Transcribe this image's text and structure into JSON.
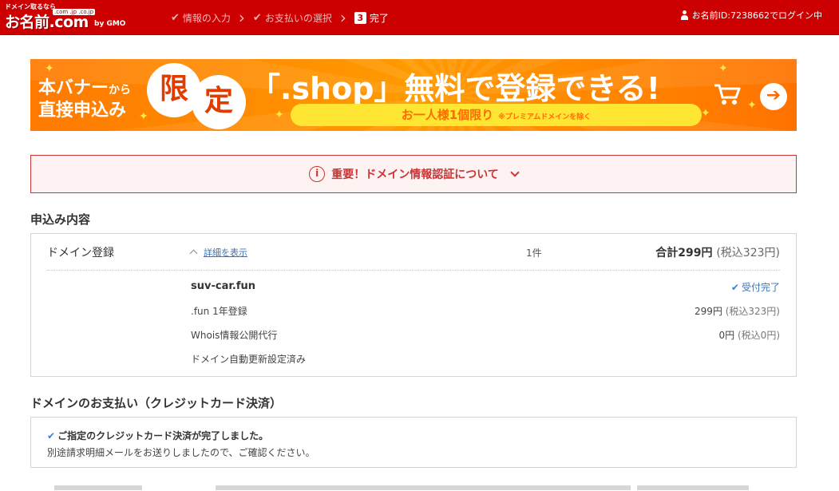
{
  "header": {
    "logo": {
      "tagline": "ドメイン取るなら",
      "tlds": ".com .jp .co.jp",
      "brand": "お名前.com",
      "by": "by GMO"
    },
    "steps": [
      {
        "label": "情報の入力",
        "state": "done"
      },
      {
        "label": "お支払いの選択",
        "state": "done"
      },
      {
        "number": "3",
        "label": "完了",
        "state": "current"
      }
    ],
    "login_status": "お名前ID:7238662でログイン中"
  },
  "banner": {
    "line1_a": "本バナー",
    "line1_b": "から",
    "line2": "直接申込み",
    "badge1": "限",
    "badge2": "定",
    "headline": "「.shop」無料で登録できる!",
    "pill_text": "お一人様1個限り",
    "pill_note": "※プレミアムドメインを除く",
    "arrow": "➔"
  },
  "notice": {
    "icon": "i",
    "text": "重要！ドメイン情報認証について"
  },
  "order_section": {
    "title": "申込み内容",
    "item_name": "ドメイン登録",
    "detail_link": "詳細を表示",
    "quantity": "1件",
    "total": "合計299円",
    "total_tax": "(税込323円)",
    "domain": "suv-car.fun",
    "status": "受付完了",
    "lines": [
      {
        "label": ".fun 1年登録",
        "price": "299円",
        "tax": "(税込323円)"
      },
      {
        "label": "Whois情報公開代行",
        "price": "0円",
        "tax": "(税込0円)"
      },
      {
        "label": "ドメイン自動更新設定済み",
        "price": "",
        "tax": ""
      }
    ]
  },
  "payment_section": {
    "title": "ドメインのお支払い（クレジットカード決済）",
    "message": "ご指定のクレジットカード決済が完了しました。",
    "sub_message": "別途請求明細メールをお送りしましたので、ご確認ください。"
  },
  "colors": {
    "header_red": "#cc0000",
    "banner_orange": "#ff8a00",
    "notice_red": "#cc3333",
    "link_blue": "#3a73b8",
    "check_blue": "#3a7de0"
  }
}
